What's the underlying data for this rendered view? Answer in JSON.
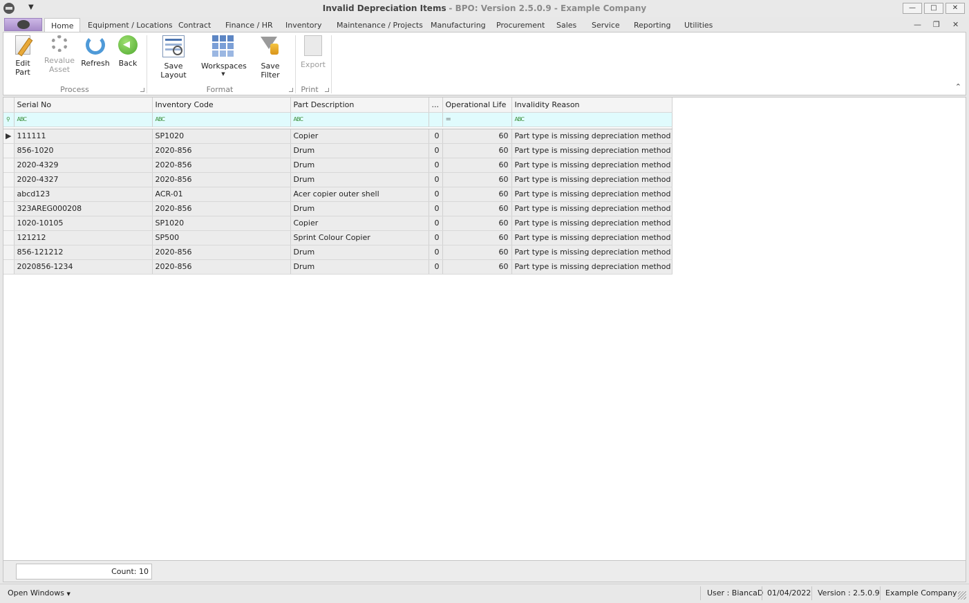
{
  "window": {
    "title": "Invalid Depreciation Items",
    "subtitle": "BPO: Version 2.5.0.9 - Example Company",
    "minimize": "—",
    "restore": "□",
    "close": "✕"
  },
  "tabs": [
    "Home",
    "Equipment / Locations",
    "Contract",
    "Finance / HR",
    "Inventory",
    "Maintenance / Projects",
    "Manufacturing",
    "Procurement",
    "Sales",
    "Service",
    "Reporting",
    "Utilities"
  ],
  "mdi": {
    "minimize": "—",
    "restore": "❐",
    "close": "✕"
  },
  "ribbon": {
    "process": {
      "label": "Process",
      "edit_part": "Edit Part",
      "revalue_asset_1": "Revalue",
      "revalue_asset_2": "Asset",
      "refresh": "Refresh",
      "back": "Back"
    },
    "format": {
      "label": "Format",
      "save_layout": "Save Layout",
      "workspaces": "Workspaces",
      "save_filter": "Save Filter"
    },
    "print": {
      "label": "Print",
      "export": "Export"
    },
    "collapse_glyph": "⌃"
  },
  "grid": {
    "columns": [
      "Serial No",
      "Inventory Code",
      "Part Description",
      "...",
      "Operational Life",
      "Invalidity Reason"
    ],
    "filter_glyphs": {
      "text": "ABC",
      "equals": "=",
      "pin": "⚲"
    },
    "row_indicator": "▶",
    "rows": [
      [
        "111111",
        "SP1020",
        "Copier",
        "0",
        "60",
        "Part type is missing depreciation method"
      ],
      [
        "856-1020",
        "2020-856",
        "Drum",
        "0",
        "60",
        "Part type is missing depreciation method"
      ],
      [
        "2020-4329",
        "2020-856",
        "Drum",
        "0",
        "60",
        "Part type is missing depreciation method"
      ],
      [
        "2020-4327",
        "2020-856",
        "Drum",
        "0",
        "60",
        "Part type is missing depreciation method"
      ],
      [
        "abcd123",
        "ACR-01",
        "Acer copier outer shell",
        "0",
        "60",
        "Part type is missing depreciation method"
      ],
      [
        "323AREG000208",
        "2020-856",
        "Drum",
        "0",
        "60",
        "Part type is missing depreciation method"
      ],
      [
        "1020-10105",
        "SP1020",
        "Copier",
        "0",
        "60",
        "Part type is missing depreciation method"
      ],
      [
        "121212",
        "SP500",
        "Sprint Colour Copier",
        "0",
        "60",
        "Part type is missing depreciation method"
      ],
      [
        "856-121212",
        "2020-856",
        "Drum",
        "0",
        "60",
        "Part type is missing depreciation method"
      ],
      [
        "2020856-1234",
        "2020-856",
        "Drum",
        "0",
        "60",
        "Part type is missing depreciation method"
      ]
    ]
  },
  "footer": {
    "count": "Count: 10"
  },
  "statusbar": {
    "open_windows": "Open Windows",
    "user": "User : BiancaD",
    "date": "01/04/2022",
    "version": "Version : 2.5.0.9",
    "company": "Example Company"
  },
  "colors": {
    "filter_row": "#e0fbfd",
    "data_row": "#ececec",
    "accent_green": "#4fa830"
  }
}
